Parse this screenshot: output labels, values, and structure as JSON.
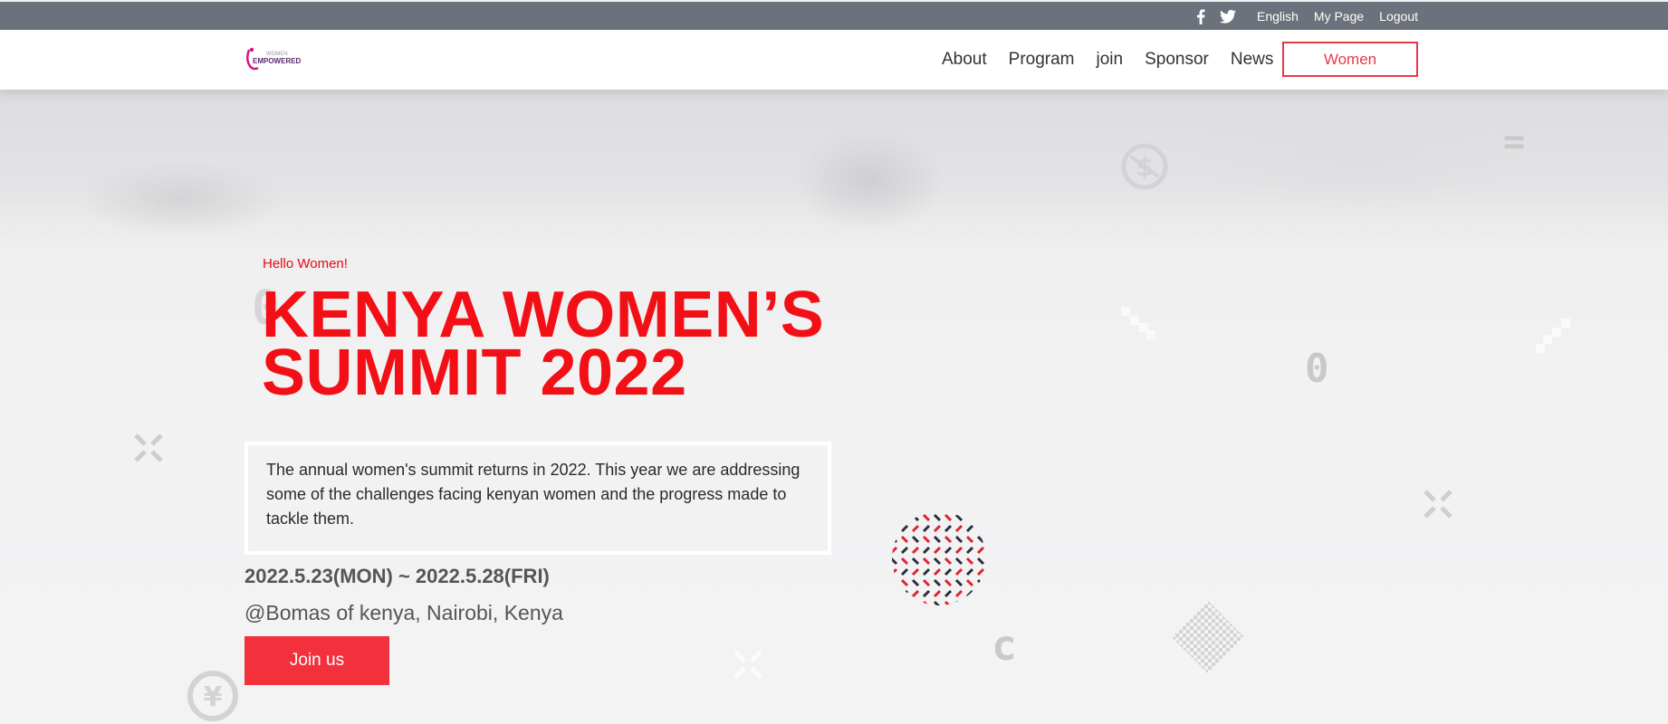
{
  "topbar": {
    "social": [
      {
        "icon": "facebook-icon"
      },
      {
        "icon": "twitter-icon"
      }
    ],
    "links": [
      "English",
      "My Page",
      "Logout"
    ]
  },
  "header": {
    "logo_text_top": "WOMEN",
    "logo_text_main": "EMPOWERED",
    "nav": [
      "About",
      "Program",
      "join",
      "Sponsor",
      "News"
    ],
    "highlight_button": "Women"
  },
  "hero": {
    "hello": "Hello Women!",
    "title_line1": "KENYA WOMEN’S",
    "title_line2": "SUMMIT 2022",
    "description": "The annual women's summit returns in 2022. This year we are addressing some of the challenges facing kenyan women and the progress made to tackle them.",
    "date": "2022.5.23(MON) ~ 2022.5.28(FRI)",
    "venue": "@Bomas of kenya, Nairobi, Kenya",
    "join_label": "Join us"
  },
  "decorations": [
    "dollar-coin-icon",
    "yen-coin-icon",
    "zero-glyph",
    "c-glyph",
    "equals-glyph"
  ],
  "colors": {
    "accent": "#f20f15",
    "button": "#f2313d",
    "topbar": "#6c727b"
  }
}
